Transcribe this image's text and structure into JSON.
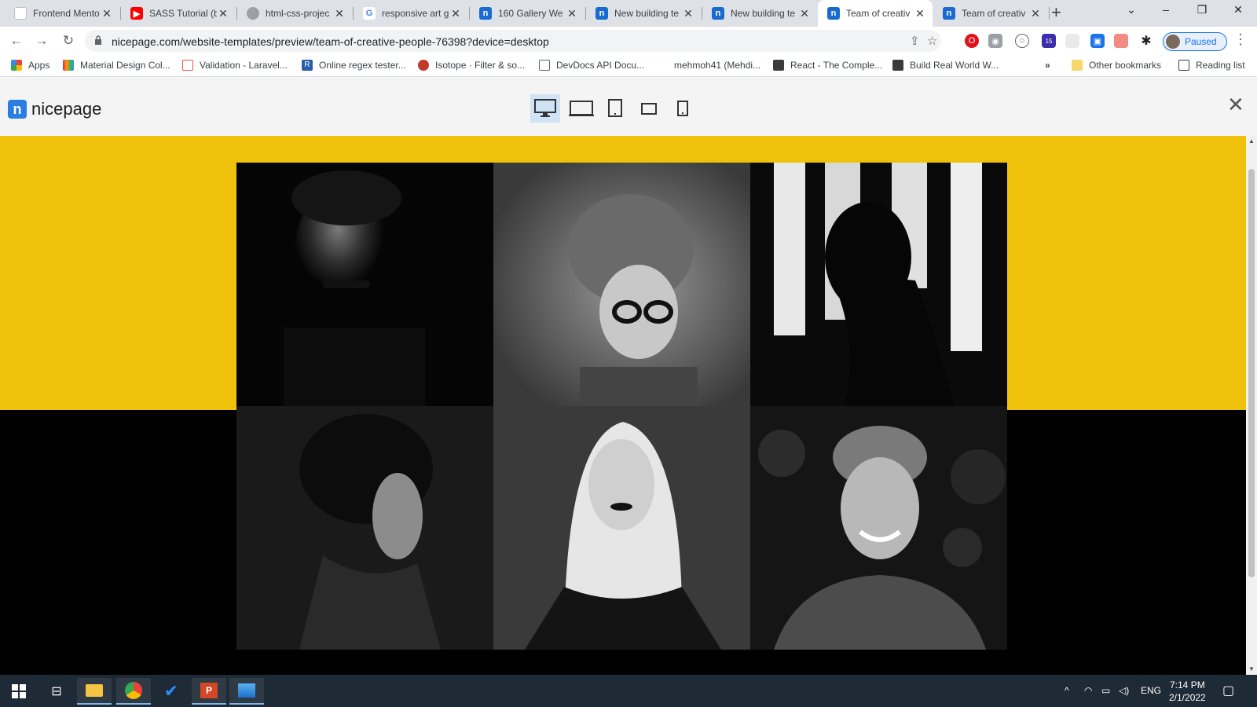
{
  "tabs": [
    {
      "title": "Frontend Mento",
      "favicon": "frontend-mentor-icon"
    },
    {
      "title": "SASS Tutorial (b",
      "favicon": "youtube-icon"
    },
    {
      "title": "html-css-projec",
      "favicon": "github-icon"
    },
    {
      "title": "responsive art g",
      "favicon": "google-icon"
    },
    {
      "title": "160 Gallery We",
      "favicon": "nicepage-icon"
    },
    {
      "title": "New building te",
      "favicon": "nicepage-icon"
    },
    {
      "title": "New building te",
      "favicon": "nicepage-icon"
    },
    {
      "title": "Team of creativ",
      "favicon": "nicepage-icon",
      "active": true
    },
    {
      "title": "Team of creativ",
      "favicon": "nicepage-icon"
    }
  ],
  "address": {
    "url": "nicepage.com/website-templates/preview/team-of-creative-people-76398?device=desktop"
  },
  "profile": {
    "label": "Paused"
  },
  "extensions": {
    "badge_count": "15"
  },
  "bookmarks": [
    {
      "label": "Apps"
    },
    {
      "label": "Material Design Col..."
    },
    {
      "label": "Validation - Laravel..."
    },
    {
      "label": "Online regex tester..."
    },
    {
      "label": "Isotope · Filter & so..."
    },
    {
      "label": "DevDocs API Docu..."
    },
    {
      "label": "mehmoh41 (Mehdi..."
    },
    {
      "label": "React - The Comple..."
    },
    {
      "label": "Build Real World W..."
    },
    {
      "label": "»"
    },
    {
      "label": "Other bookmarks"
    },
    {
      "label": "Reading list"
    }
  ],
  "nicepage": {
    "logo_letter": "n",
    "logo_text": "nicepage",
    "devices": [
      "desktop",
      "laptop",
      "tablet",
      "tablet-landscape",
      "mobile"
    ],
    "active_device": "desktop"
  },
  "colors": {
    "hero_yellow": "#f0c10b",
    "accent_blue": "#2a7de1"
  },
  "taskbar": {
    "language": "ENG",
    "time": "7:14 PM",
    "date": "2/1/2022"
  }
}
